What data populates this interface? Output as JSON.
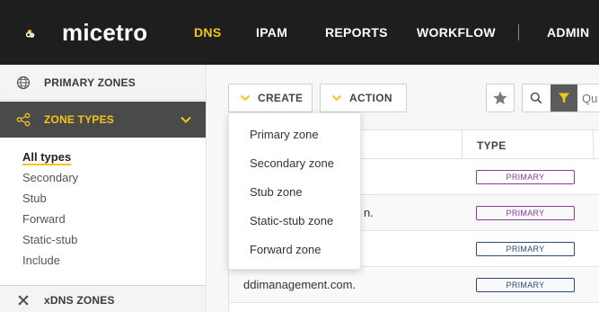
{
  "app": {
    "logo_text": "micetro",
    "brand_color": "#f5c518",
    "logo_icon": "micetro-logo-icon"
  },
  "nav": {
    "items": [
      {
        "label": "DNS",
        "active": true
      },
      {
        "label": "IPAM"
      },
      {
        "label": "REPORTS"
      },
      {
        "label": "WORKFLOW"
      },
      {
        "label": "ADMIN"
      }
    ]
  },
  "sidebar": {
    "primary_zones": {
      "label": "PRIMARY ZONES",
      "icon": "globe-icon"
    },
    "zone_types": {
      "label": "ZONE TYPES",
      "icon": "share-nodes-icon",
      "expanded": true
    },
    "filters": [
      {
        "label": "All types",
        "active": true
      },
      {
        "label": "Secondary"
      },
      {
        "label": "Stub"
      },
      {
        "label": "Forward"
      },
      {
        "label": "Static-stub"
      },
      {
        "label": "Include"
      }
    ],
    "xdns_zones": {
      "label": "xDNS ZONES",
      "icon": "x-icon"
    }
  },
  "toolbar": {
    "create_label": "CREATE",
    "action_label": "ACTION",
    "search_placeholder": "Qu"
  },
  "table": {
    "columns": {
      "type": "TYPE"
    },
    "rows": [
      {
        "name": "",
        "type": "PRIMARY",
        "color": "#8a3a9a"
      },
      {
        "name": "n.",
        "type": "PRIMARY",
        "color": "#8a3a9a"
      },
      {
        "name": "",
        "type": "PRIMARY",
        "color": "#2f4a6f"
      },
      {
        "name": "ddimanagement.com.",
        "type": "PRIMARY",
        "color": "#2f4a6f"
      }
    ]
  },
  "create_menu": {
    "items": [
      "Primary zone",
      "Secondary zone",
      "Stub zone",
      "Static-stub zone",
      "Forward zone"
    ]
  }
}
